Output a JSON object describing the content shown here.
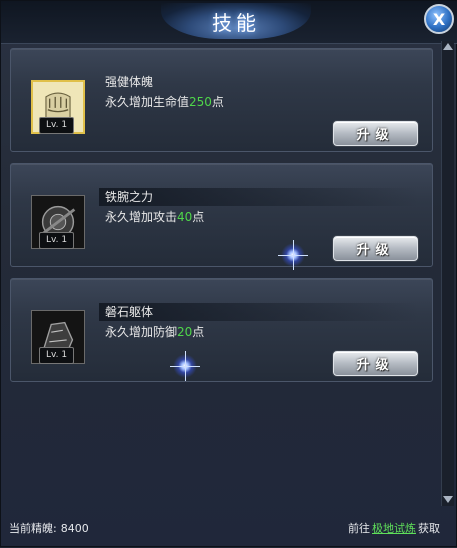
{
  "window": {
    "title": "技能",
    "close_label": "X"
  },
  "skills": [
    {
      "name": "强健体魄",
      "desc_prefix": "永久增加生命值",
      "desc_value": "250",
      "desc_suffix": "点",
      "level": "Lv. 1",
      "upgrade_label": "升级",
      "icon": "fist-icon",
      "active": true
    },
    {
      "name": "铁腕之力",
      "desc_prefix": "永久增加攻击",
      "desc_value": "40",
      "desc_suffix": "点",
      "level": "Lv. 1",
      "upgrade_label": "升级",
      "icon": "iron-wrist-icon",
      "active": false
    },
    {
      "name": "磐石躯体",
      "desc_prefix": "永久增加防御",
      "desc_value": "20",
      "desc_suffix": "点",
      "level": "Lv. 1",
      "upgrade_label": "升级",
      "icon": "stone-body-icon",
      "active": false
    }
  ],
  "footer": {
    "essence_label": "当前精魄:",
    "essence_value": "8400",
    "goto_prefix": "前往",
    "goto_link": "极地试炼",
    "goto_suffix": "获取"
  },
  "colors": {
    "highlight_number": "#4fd64a",
    "link": "#5fe05a",
    "accent": "#2d6fc2"
  }
}
